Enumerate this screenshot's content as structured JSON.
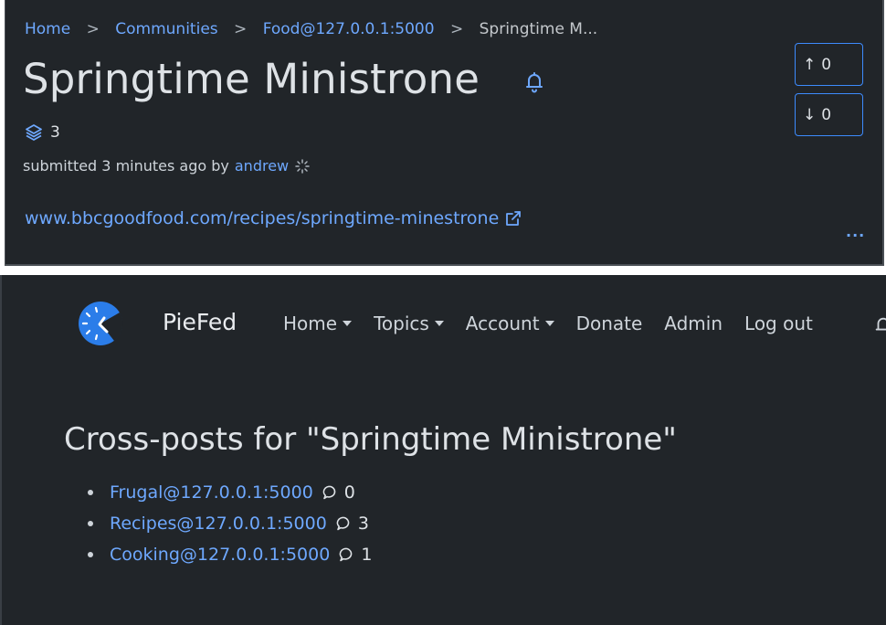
{
  "breadcrumb": {
    "items": [
      "Home",
      "Communities",
      "Food@127.0.0.1:5000"
    ],
    "current": "Springtime M..."
  },
  "post": {
    "title": "Springtime Ministrone",
    "crosspost_count": "3",
    "submitted_prefix": "submitted 3 minutes ago by",
    "author": "andrew",
    "link": "www.bbcgoodfood.com/recipes/springtime-minestrone",
    "upvotes": "0",
    "downvotes": "0",
    "more": "..."
  },
  "navbar": {
    "brand": "PieFed",
    "items": [
      {
        "label": "Home",
        "dropdown": true
      },
      {
        "label": "Topics",
        "dropdown": true
      },
      {
        "label": "Account",
        "dropdown": true
      },
      {
        "label": "Donate",
        "dropdown": false
      },
      {
        "label": "Admin",
        "dropdown": false
      },
      {
        "label": "Log out",
        "dropdown": false
      }
    ]
  },
  "crossposts": {
    "heading": "Cross-posts for \"Springtime Ministrone\"",
    "items": [
      {
        "community": "Frugal@127.0.0.1:5000",
        "comments": "0"
      },
      {
        "community": "Recipes@127.0.0.1:5000",
        "comments": "3"
      },
      {
        "community": "Cooking@127.0.0.1:5000",
        "comments": "1"
      }
    ]
  },
  "colors": {
    "background": "#212529",
    "link": "#6ea8fe",
    "accent_border": "#3d8bfd",
    "logo": "#2b7de9"
  },
  "icons": {
    "bell": "bell-icon",
    "layers": "layers-icon",
    "loading": "spinner-icon",
    "external": "external-link-icon",
    "comment": "comment-icon"
  }
}
